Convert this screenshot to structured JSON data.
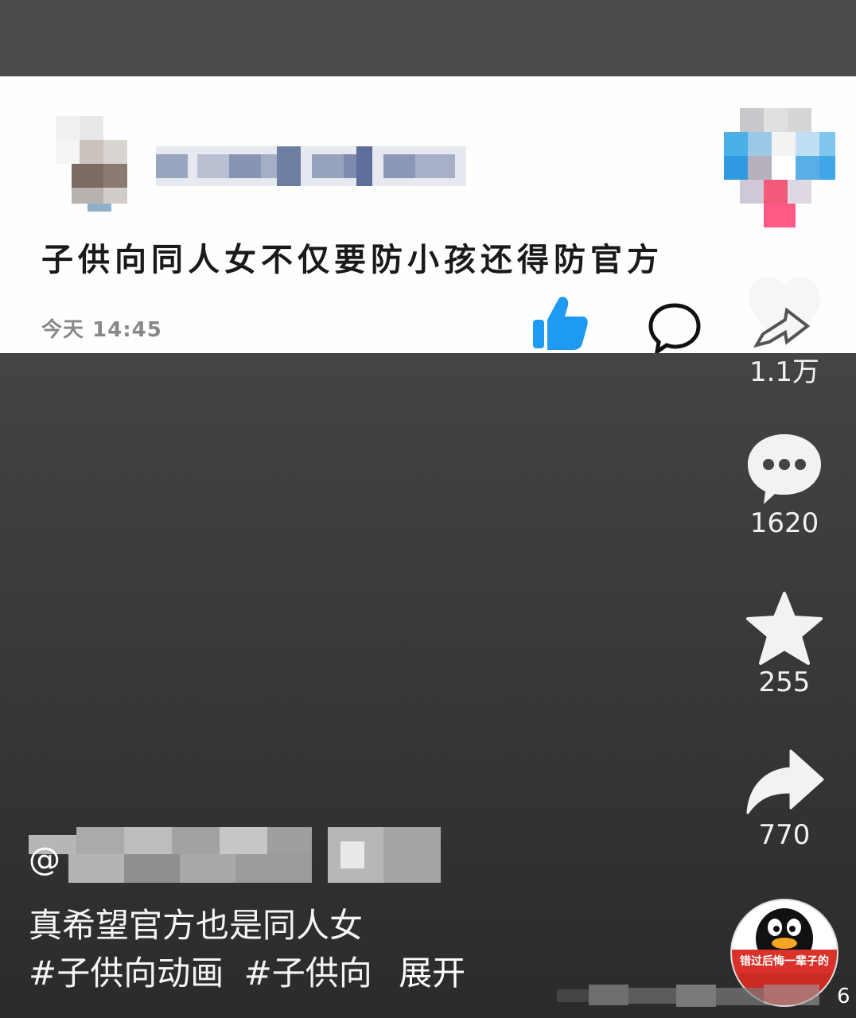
{
  "card": {
    "post_text": "子供向同人女不仅要防小孩还得防官方",
    "timestamp": "今天 14:45",
    "like_icon": "thumbs-up-icon",
    "comment_icon": "speech-bubble-icon",
    "like_color": "#1E9BF0"
  },
  "rail": {
    "like_count": "1.1万",
    "comment_count": "1620",
    "favorite_count": "255",
    "share_count": "770"
  },
  "caption": {
    "at": "@",
    "text": "真希望官方也是同人女",
    "tag1": "#子供向动画",
    "tag2": "#子供向",
    "expand": "展开"
  },
  "avatar": {
    "banner_text": "错过后悔一辈子的"
  },
  "corner": {
    "digit": "6"
  }
}
